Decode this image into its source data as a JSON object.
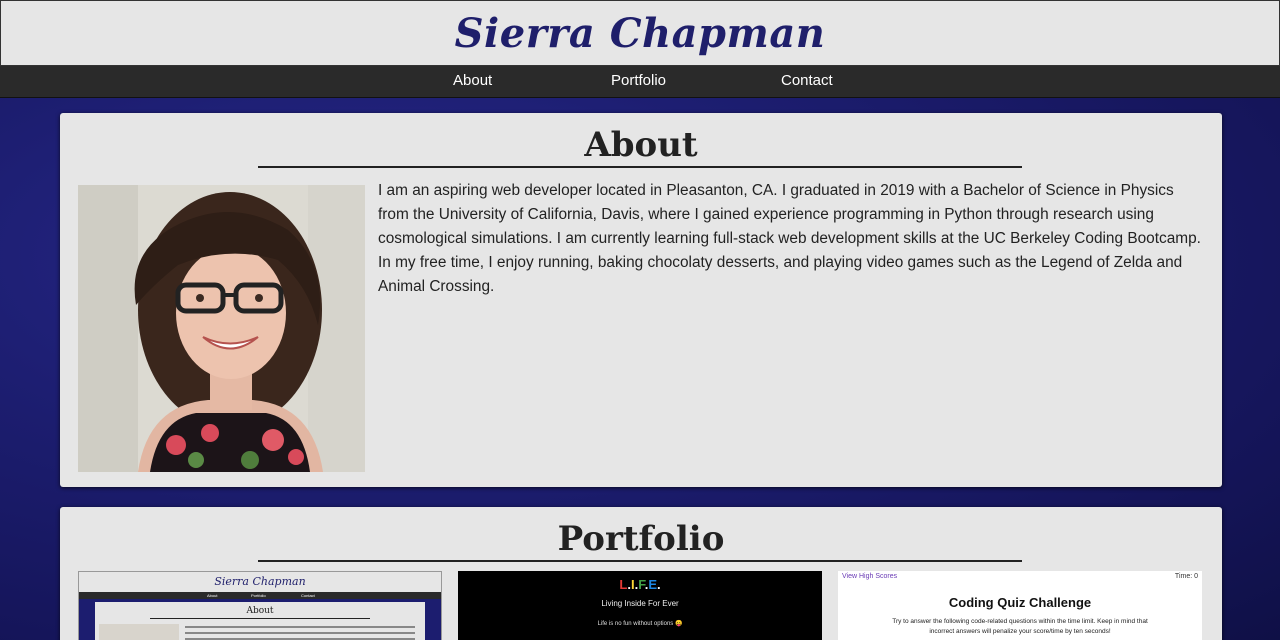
{
  "header": {
    "title": "Sierra Chapman"
  },
  "nav": {
    "about": "About",
    "portfolio": "Portfolio",
    "contact": "Contact"
  },
  "about": {
    "heading": "About",
    "photo_alt": "Photo of Sierra Chapman",
    "bio": "I am an aspiring web developer located in Pleasanton, CA. I graduated in 2019 with a Bachelor of Science in Physics from the University of California, Davis, where I gained experience programming in Python through research using cosmological simulations. I am currently learning full-stack web development skills at the UC Berkeley Coding Bootcamp. In my free time, I enjoy running, baking chocolaty desserts, and playing video games such as the Legend of Zelda and Animal Crossing."
  },
  "portfolio": {
    "heading": "Portfolio",
    "projects": [
      {
        "preview": "portfolio-site",
        "header_title": "Sierra Chapman",
        "nav": [
          "About",
          "Portfolio",
          "Contact"
        ],
        "section_title": "About"
      },
      {
        "preview": "life-app",
        "title": "L.I.F.E.",
        "subtitle": "Living Inside For Ever",
        "tagline": "Life is no fun without options 😛"
      },
      {
        "preview": "coding-quiz",
        "link": "View High Scores",
        "timer": "Time: 0",
        "title": "Coding Quiz Challenge",
        "description": "Try to answer the following code-related questions within the time limit. Keep in mind that incorrect answers will penalize your score/time by ten seconds!"
      }
    ]
  },
  "colors": {
    "background": "#1c1d6f",
    "card": "#e6e6e6",
    "navbar": "#2a2a2a",
    "title": "#1f1f6b"
  }
}
